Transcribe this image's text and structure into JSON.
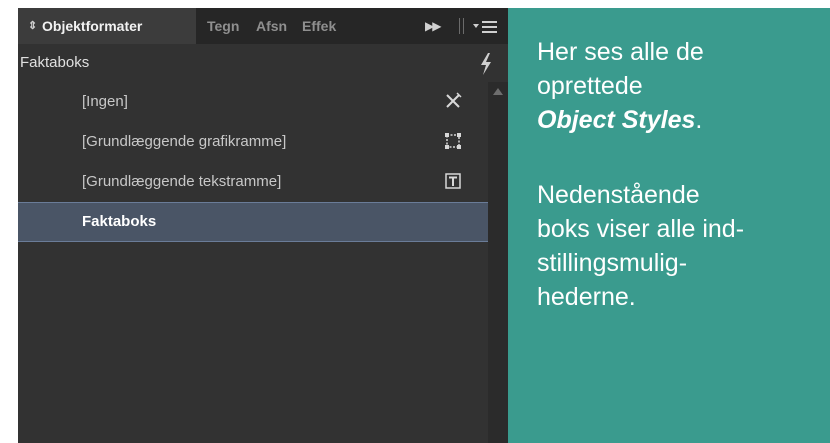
{
  "panel": {
    "tabs": [
      {
        "label": "Objektformater",
        "active": true
      },
      {
        "label": "Tegn",
        "active": false
      },
      {
        "label": "Afsn",
        "active": false
      },
      {
        "label": "Effek",
        "active": false
      }
    ],
    "tab_icons": [
      "collapse-arrows-icon",
      "fast-forward-icon",
      "panel-menu-icon"
    ],
    "current_style": "Faktaboks",
    "styles": [
      {
        "label": "[Ingen]",
        "icon": "no-style-icon",
        "selected": false
      },
      {
        "label": "[Grundlæggende grafikramme]",
        "icon": "graphic-frame-icon",
        "selected": false
      },
      {
        "label": "[Grundlæggende tekstramme]",
        "icon": "text-frame-icon",
        "selected": false
      },
      {
        "label": "Faktaboks",
        "icon": "",
        "selected": true
      }
    ]
  },
  "note": {
    "line1": "Her ses alle de",
    "line2": "oprettede",
    "line3_emphasis": "Object Styles",
    "line3_suffix": ".",
    "line4": "Nedenstående",
    "line5": "boks viser alle ind-",
    "line6": "stillingsmulig-",
    "line7": "hederne."
  },
  "colors": {
    "panel_bg": "#323232",
    "selection": "#4a5566",
    "note_bg": "#3a9b8e"
  }
}
